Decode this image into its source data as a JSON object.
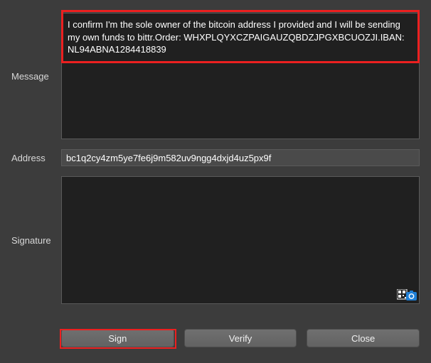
{
  "labels": {
    "message": "Message",
    "address": "Address",
    "signature": "Signature"
  },
  "fields": {
    "message": "I confirm I'm the sole owner of the bitcoin address I provided and I will be sending my own funds to bittr.Order: WHXPLQYXCZPAIGAUZQBDZJPGXBCUOZJI.IBAN: NL94ABNA1284418839",
    "address": "bc1q2cy4zm5ye7fe6j9m582uv9ngg4dxjd4uz5px9f",
    "signature": ""
  },
  "buttons": {
    "sign": "Sign",
    "verify": "Verify",
    "close": "Close"
  }
}
